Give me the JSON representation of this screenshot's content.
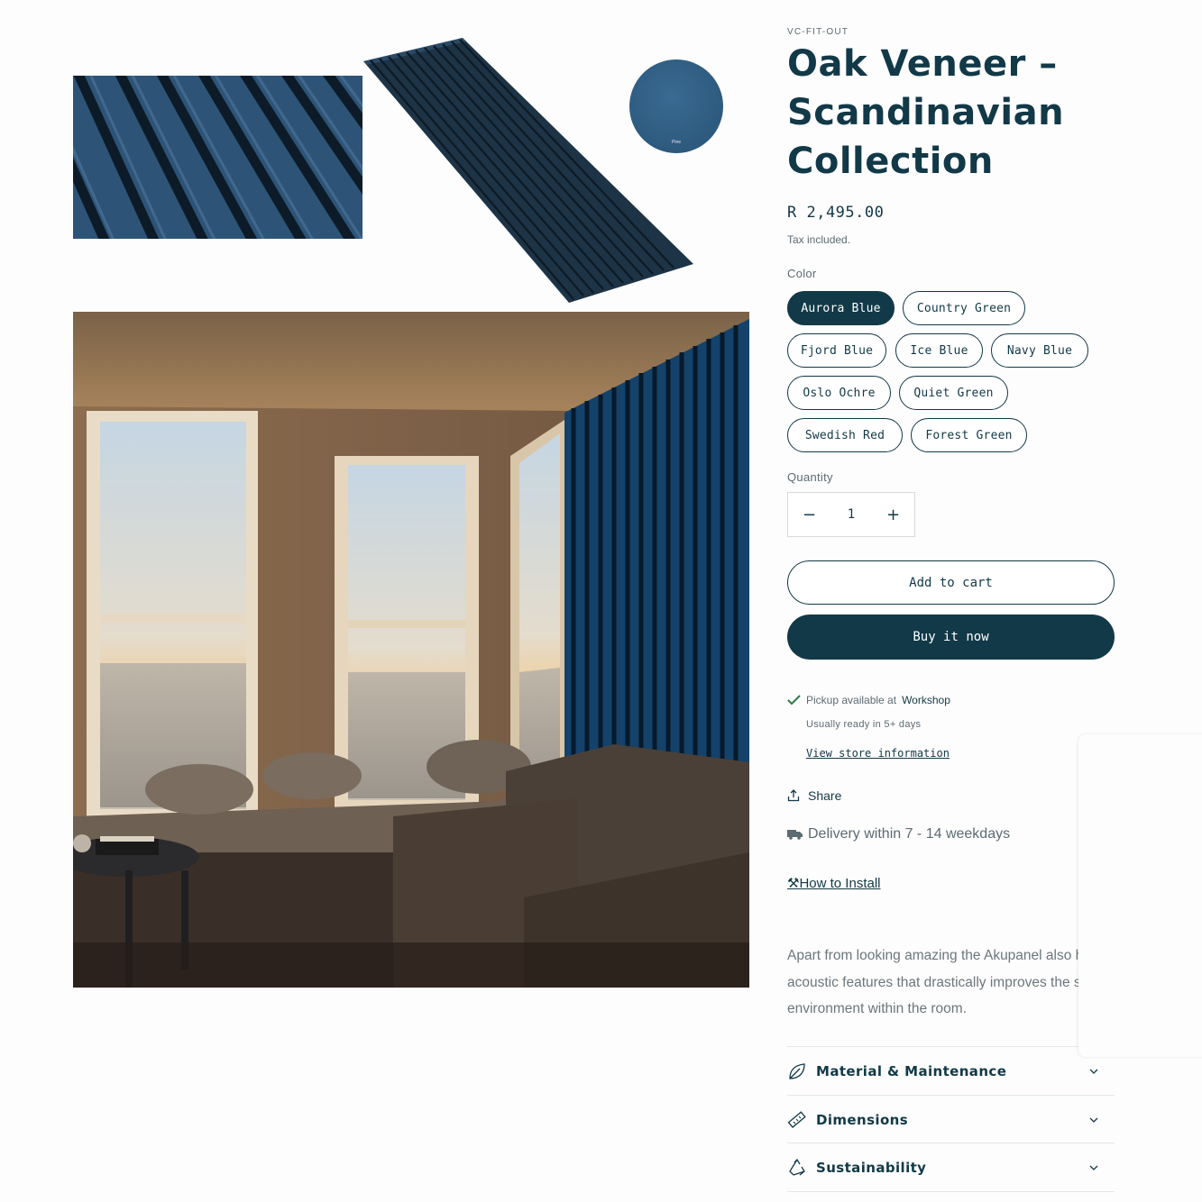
{
  "product": {
    "vendor": "VC-FIT-OUT",
    "title": "Oak Veneer – Scandinavian Collection",
    "price": "R 2,495.00",
    "tax_note": "Tax included."
  },
  "gallery": {
    "swatch_label": "Pine"
  },
  "color": {
    "label": "Color",
    "options": [
      "Aurora Blue",
      "Country Green",
      "Fjord Blue",
      "Ice Blue",
      "Navy Blue",
      "Oslo Ochre",
      "Quiet Green",
      "Swedish Red",
      "Forest Green"
    ],
    "selected": "Aurora Blue"
  },
  "quantity": {
    "label": "Quantity",
    "value": "1",
    "minus": "−",
    "plus": "+"
  },
  "actions": {
    "add_to_cart": "Add to cart",
    "buy_now": "Buy it now"
  },
  "pickup": {
    "text": "Pickup available at",
    "location": "Workshop",
    "ready": "Usually ready in 5+ days",
    "store_link": "View store information"
  },
  "share_label": "Share",
  "delivery_text": "Delivery within 7 - 14 weekdays",
  "install_link": "How to Install",
  "description": "Apart from looking amazing the Akupanel also have acoustic features that drastically improves the sound environment within the room.",
  "accordions": [
    {
      "title": "Material & Maintenance",
      "icon": "leaf-icon"
    },
    {
      "title": "Dimensions",
      "icon": "ruler-icon"
    },
    {
      "title": "Sustainability",
      "icon": "recycle-icon"
    }
  ],
  "colors": {
    "brand": "#123947",
    "panel_blue": "#2f5f86",
    "muted_text": "#5c6b72"
  }
}
